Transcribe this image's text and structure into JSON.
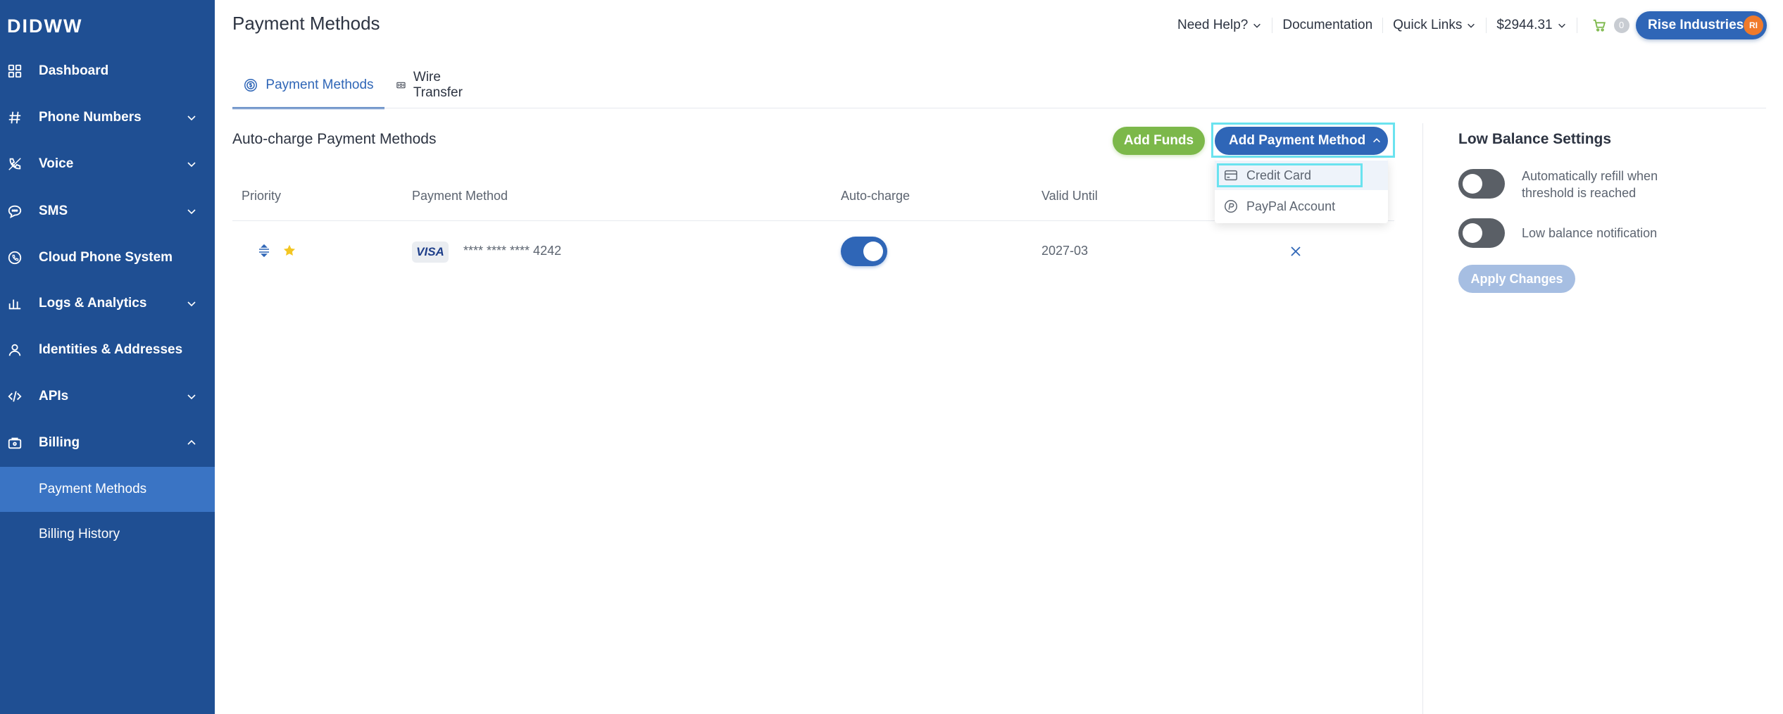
{
  "app": {
    "logo_text": "DIDWW"
  },
  "sidebar": {
    "items": [
      {
        "label": "Dashboard",
        "icon": "grid-icon"
      },
      {
        "label": "Phone Numbers",
        "icon": "hash-icon"
      },
      {
        "label": "Voice",
        "icon": "phone-icon"
      },
      {
        "label": "SMS",
        "icon": "chat-icon"
      },
      {
        "label": "Cloud Phone System",
        "icon": "phone-circle-icon"
      },
      {
        "label": "Logs & Analytics",
        "icon": "bar-chart-icon"
      },
      {
        "label": "Identities & Addresses",
        "icon": "person-icon"
      },
      {
        "label": "APIs",
        "icon": "code-icon"
      },
      {
        "label": "Billing",
        "icon": "wallet-icon"
      }
    ],
    "billing_sub": [
      {
        "label": "Payment Methods",
        "active": true
      },
      {
        "label": "Billing History",
        "active": false
      }
    ]
  },
  "header": {
    "title": "Payment Methods",
    "need_help": "Need Help?",
    "documentation": "Documentation",
    "quick_links": "Quick Links",
    "balance": "$2944.31",
    "cart_count": "0",
    "company": "Rise Industries",
    "company_initials": "RI"
  },
  "tabs": [
    {
      "label": "Payment Methods",
      "active": true
    },
    {
      "label": "Wire Transfer",
      "active": false
    }
  ],
  "autocharge": {
    "title": "Auto-charge Payment Methods",
    "add_funds": "Add Funds",
    "add_payment_method": "Add Payment Method",
    "columns": [
      "Priority",
      "Payment Method",
      "Auto-charge",
      "Valid Until"
    ],
    "rows": [
      {
        "card_brand": "VISA",
        "card_number": "**** **** **** 4242",
        "autocharge": true,
        "valid_until": "2027-03"
      }
    ],
    "dropdown": [
      "Credit Card",
      "PayPal Account"
    ]
  },
  "low_balance": {
    "title": "Low Balance Settings",
    "auto_refill_label": "Automatically refill when threshold is reached",
    "notification_label": "Low balance notification",
    "auto_refill_on": false,
    "notification_on": false,
    "apply": "Apply Changes"
  },
  "colors": {
    "sidebar_bg": "#1f4f93",
    "sidebar_active": "#3a74c4",
    "primary": "#2f66b7",
    "green": "#7cb84a",
    "highlight": "#6ae3ef",
    "avatar": "#f07a2a"
  }
}
